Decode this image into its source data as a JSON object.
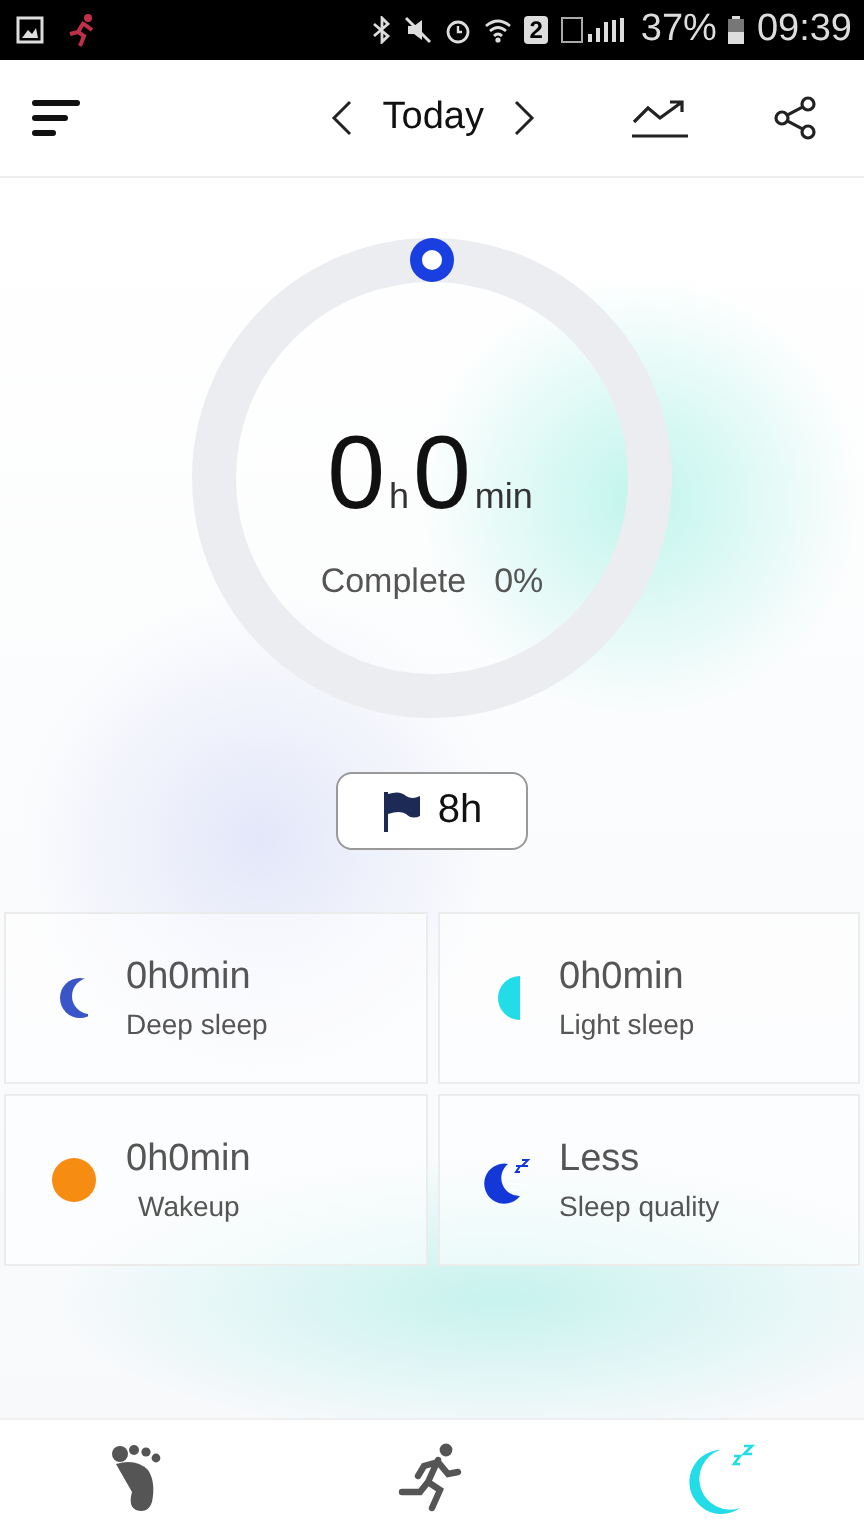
{
  "status_bar": {
    "sim": "2",
    "battery": "37%",
    "time": "09:39"
  },
  "header": {
    "date": "Today"
  },
  "ring": {
    "hours": "0",
    "hours_unit": "h",
    "minutes": "0",
    "minutes_unit": "min",
    "complete_label": "Complete",
    "complete_value": "0%"
  },
  "goal": {
    "value": "8h"
  },
  "stats": [
    {
      "kind": "deep",
      "value": "0h0min",
      "label": "Deep sleep"
    },
    {
      "kind": "light",
      "value": "0h0min",
      "label": "Light sleep"
    },
    {
      "kind": "wake",
      "value": "0h0min",
      "label": "Wakeup"
    },
    {
      "kind": "quality",
      "value": "Less",
      "label": "Sleep quality"
    }
  ],
  "nav": [
    {
      "kind": "steps",
      "selected": false
    },
    {
      "kind": "run",
      "selected": false
    },
    {
      "kind": "sleep",
      "selected": true
    }
  ]
}
